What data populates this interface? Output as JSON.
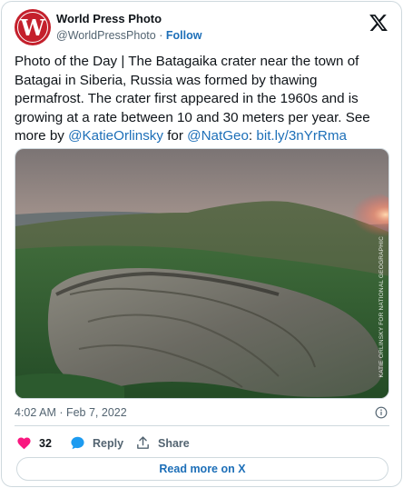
{
  "account": {
    "name": "World Press Photo",
    "handle": "@WorldPressPhoto",
    "separator": "·",
    "follow_label": "Follow",
    "avatar_letter": "W",
    "avatar_color": "#c4202c"
  },
  "tweet": {
    "text_prefix": "Photo of the Day | The Batagaika crater near the town of Batagai in Siberia, Russia was formed by thawing permafrost. The crater first appeared in the 1960s and is growing at a rate between 10 and 30 meters per year. See more by ",
    "mention_1": "@KatieOrlinsky",
    "text_mid": " for ",
    "mention_2": "@NatGeo",
    "text_colon": ": ",
    "link": "bit.ly/3nYrRma"
  },
  "photo": {
    "credit": "KATIE ORLINSKY FOR NATIONAL GEOGRAPHIC"
  },
  "meta": {
    "timestamp": "4:02 AM · Feb 7, 2022"
  },
  "actions": {
    "like_count": "32",
    "reply_label": "Reply",
    "share_label": "Share"
  },
  "read_more_label": "Read more on X",
  "colors": {
    "link": "#1d6fb8",
    "muted": "#536471",
    "like": "#f91880",
    "border": "#cfd9de"
  }
}
